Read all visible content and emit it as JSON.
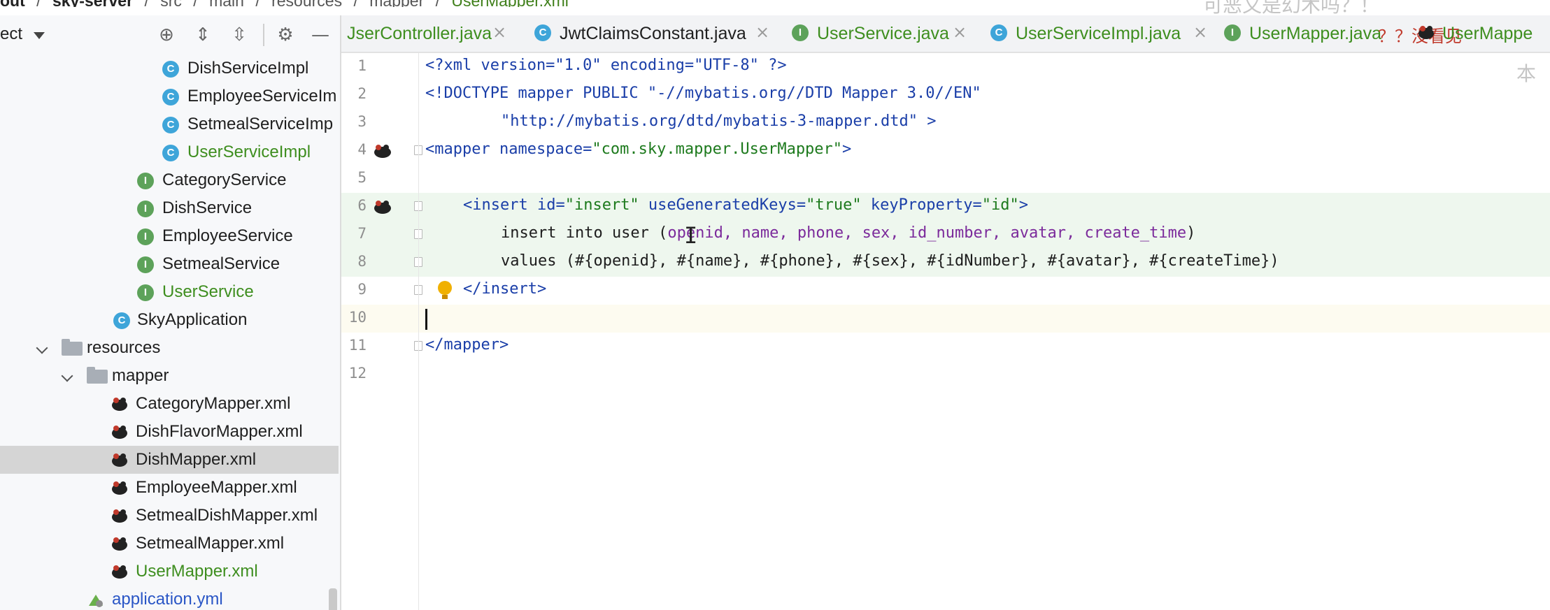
{
  "breadcrumb": {
    "items": [
      "out",
      "sky-server",
      "src",
      "main",
      "resources",
      "mapper",
      "UserMapper.xml"
    ]
  },
  "overlay_text": "可恶又是幻术吗？！",
  "overlay_text_2": "？？没看见",
  "overlay_text_3": "本",
  "project_panel": {
    "title": "ect",
    "tree": [
      {
        "label": "DishServiceImpl",
        "icon": "class-icon",
        "style": "normal"
      },
      {
        "label": "EmployeeServiceIm",
        "icon": "class-icon",
        "style": "normal"
      },
      {
        "label": "SetmealServiceImp",
        "icon": "class-icon",
        "style": "normal"
      },
      {
        "label": "UserServiceImpl",
        "icon": "class-icon",
        "style": "green"
      },
      {
        "label": "CategoryService",
        "icon": "interface-icon",
        "style": "normal"
      },
      {
        "label": "DishService",
        "icon": "interface-icon",
        "style": "normal"
      },
      {
        "label": "EmployeeService",
        "icon": "interface-icon",
        "style": "normal"
      },
      {
        "label": "SetmealService",
        "icon": "interface-icon",
        "style": "normal"
      },
      {
        "label": "UserService",
        "icon": "interface-icon",
        "style": "green"
      },
      {
        "label": "SkyApplication",
        "icon": "spring-boot-class-icon",
        "style": "normal"
      },
      {
        "label": "resources",
        "icon": "resources-folder-icon",
        "style": "normal"
      },
      {
        "label": "mapper",
        "icon": "folder-icon",
        "style": "normal"
      },
      {
        "label": "CategoryMapper.xml",
        "icon": "mybatis-xml-icon",
        "style": "normal"
      },
      {
        "label": "DishFlavorMapper.xml",
        "icon": "mybatis-xml-icon",
        "style": "normal"
      },
      {
        "label": "DishMapper.xml",
        "icon": "mybatis-xml-icon",
        "style": "selected"
      },
      {
        "label": "EmployeeMapper.xml",
        "icon": "mybatis-xml-icon",
        "style": "normal"
      },
      {
        "label": "SetmealDishMapper.xml",
        "icon": "mybatis-xml-icon",
        "style": "normal"
      },
      {
        "label": "SetmealMapper.xml",
        "icon": "mybatis-xml-icon",
        "style": "normal"
      },
      {
        "label": "UserMapper.xml",
        "icon": "mybatis-xml-icon",
        "style": "green"
      },
      {
        "label": "application.yml",
        "icon": "yaml-icon",
        "style": "blue"
      }
    ]
  },
  "tabs": [
    {
      "label": "JserController.java",
      "icon": "",
      "close": "×"
    },
    {
      "label": "JwtClaimsConstant.java",
      "icon": "class-icon",
      "close": "×"
    },
    {
      "label": "UserService.java",
      "icon": "interface-icon",
      "close": "×"
    },
    {
      "label": "UserServiceImpl.java",
      "icon": "class-icon",
      "close": "×"
    },
    {
      "label": "UserMapper.java",
      "icon": "interface-icon",
      "close": "×"
    },
    {
      "label": "UserMappe",
      "icon": "mybatis-xml-icon",
      "close": ""
    }
  ],
  "editor": {
    "line_numbers": [
      "1",
      "2",
      "3",
      "4",
      "5",
      "6",
      "7",
      "8",
      "9",
      "10",
      "11",
      "12"
    ],
    "lines": {
      "l1": "<?xml version=\"1.0\" encoding=\"UTF-8\" ?>",
      "l2": "<!DOCTYPE mapper PUBLIC \"-//mybatis.org//DTD Mapper 3.0//EN\"",
      "l3": "\"http://mybatis.org/dtd/mybatis-3-mapper.dtd\" >",
      "l4_tag": "<mapper ",
      "l4_attr": "namespace=",
      "l4_val": "\"com.sky.mapper.UserMapper\"",
      "l4_end": ">",
      "l6_tag": "<insert ",
      "l6_a1": "id=",
      "l6_v1": "\"insert\"",
      "l6_a2": " useGeneratedKeys=",
      "l6_v2": "\"true\"",
      "l6_a3": " keyProperty=",
      "l6_v3": "\"id\"",
      "l6_end": ">",
      "l7_kw": "insert into user (",
      "l7_cols": "openid, name, phone, sex, id_number, avatar, create_time",
      "l7_end": ")",
      "l8": "values (#{openid}, #{name}, #{phone}, #{sex}, #{idNumber}, #{avatar}, #{createTime})",
      "l9": "</insert>",
      "l11": "</mapper>"
    },
    "ibeam": "I"
  }
}
